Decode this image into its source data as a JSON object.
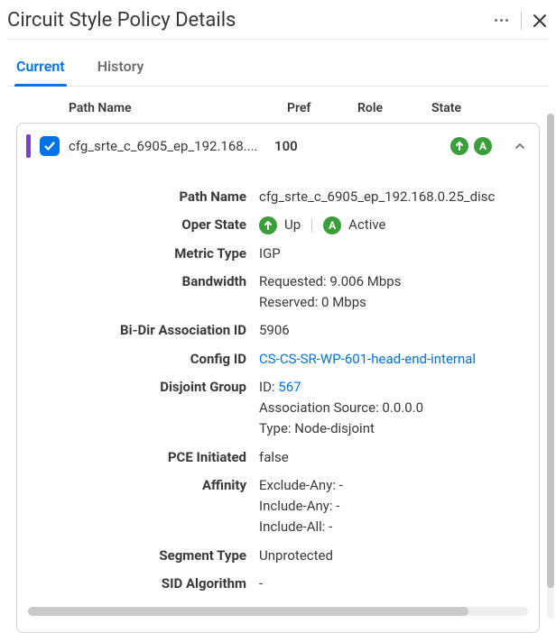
{
  "header": {
    "title": "Circuit Style Policy Details"
  },
  "tabs": {
    "current": "Current",
    "history": "History"
  },
  "columns": {
    "pathName": "Path Name",
    "pref": "Pref",
    "role": "Role",
    "state": "State"
  },
  "row": {
    "name": "cfg_srte_c_6905_ep_192.168....",
    "pref": "100",
    "upGlyph": "↑",
    "activeGlyph": "A"
  },
  "details": {
    "pathName": {
      "label": "Path Name",
      "value": "cfg_srte_c_6905_ep_192.168.0.25_disc"
    },
    "operState": {
      "label": "Oper State",
      "up": "Up",
      "active": "Active"
    },
    "metricType": {
      "label": "Metric Type",
      "value": "IGP"
    },
    "bandwidth": {
      "label": "Bandwidth",
      "requested": "Requested: 9.006 Mbps",
      "reserved": "Reserved: 0 Mbps"
    },
    "biDir": {
      "label": "Bi-Dir Association ID",
      "value": "5906"
    },
    "configId": {
      "label": "Config ID",
      "value": "CS-CS-SR-WP-601-head-end-internal"
    },
    "disjoint": {
      "label": "Disjoint Group",
      "idLabel": "ID: ",
      "id": "567",
      "source": "Association Source: 0.0.0.0",
      "type": "Type: Node-disjoint"
    },
    "pce": {
      "label": "PCE Initiated",
      "value": "false"
    },
    "affinity": {
      "label": "Affinity",
      "excl": "Exclude-Any: -",
      "inclAny": "Include-Any: -",
      "inclAll": "Include-All: -"
    },
    "segment": {
      "label": "Segment Type",
      "value": "Unprotected"
    },
    "sid": {
      "label": "SID Algorithm",
      "value": "-"
    }
  }
}
